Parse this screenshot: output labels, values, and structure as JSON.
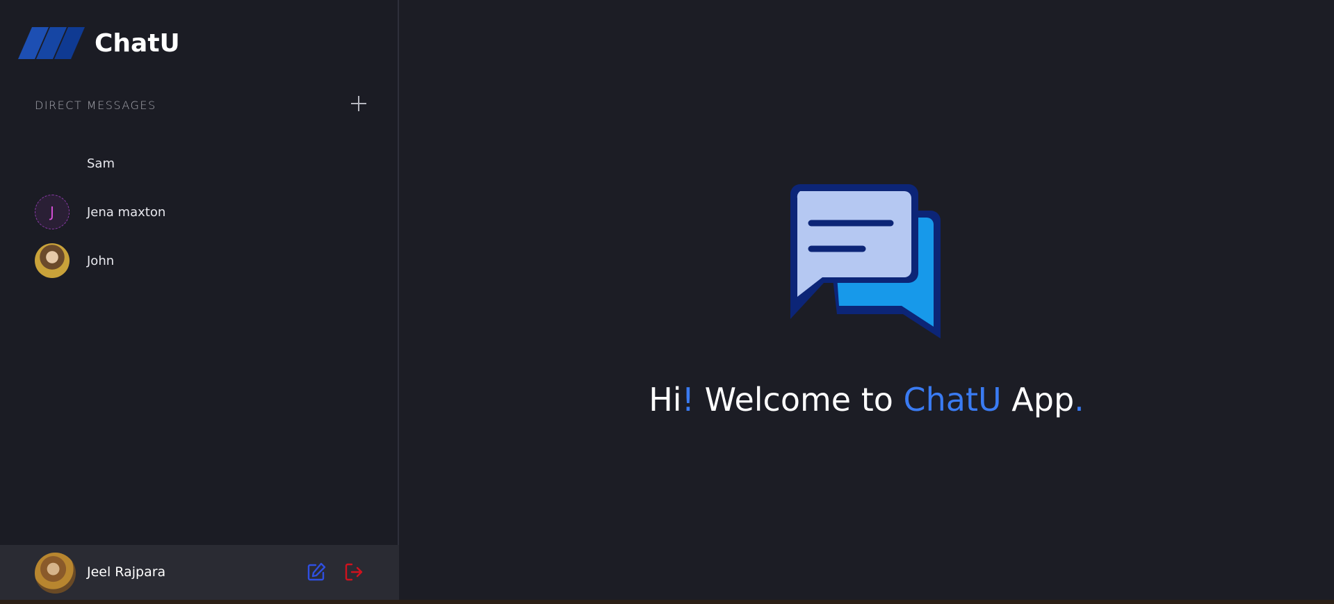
{
  "brand": {
    "name": "ChatU"
  },
  "direct_messages": {
    "title": "DIRECT MESSAGES",
    "add_icon": "plus-icon",
    "contacts": [
      {
        "name": "Sam",
        "avatar_type": "none",
        "avatar_letter": ""
      },
      {
        "name": "Jena maxton",
        "avatar_type": "letter",
        "avatar_letter": "J"
      },
      {
        "name": "John",
        "avatar_type": "photo",
        "avatar_letter": ""
      }
    ]
  },
  "user": {
    "name": "Jeel Rajpara",
    "edit_icon": "edit-icon",
    "logout_icon": "logout-icon"
  },
  "welcome": {
    "part1": "Hi",
    "exclaim": "!",
    "part2": " Welcome to ",
    "app_name": "ChatU",
    "part3": " App",
    "period": "."
  },
  "colors": {
    "accent": "#3a7bf2",
    "sidebar_bg": "#1b1c24",
    "main_bg": "#1c1d25",
    "user_bar_bg": "#2a2b33",
    "edit_icon": "#2f4fe0",
    "logout_icon": "#d0121e",
    "letter_avatar": "#d64fd8"
  }
}
